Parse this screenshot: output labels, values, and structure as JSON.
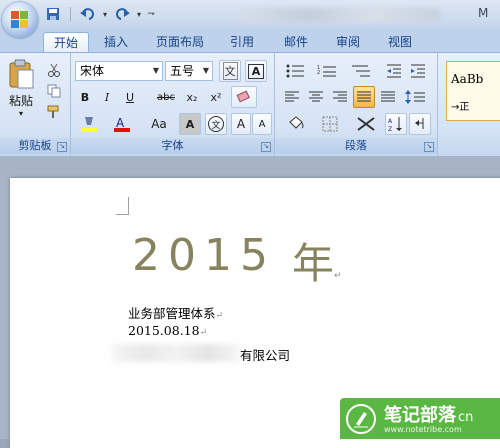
{
  "title_bar": {
    "title_suffix": "M"
  },
  "tabs": [
    "开始",
    "插入",
    "页面布局",
    "引用",
    "邮件",
    "审阅",
    "视图"
  ],
  "clipboard": {
    "paste_label": "粘贴",
    "group_label": "剪贴板"
  },
  "font": {
    "font_name": "宋体",
    "font_size": "五号",
    "bold": "B",
    "italic": "I",
    "underline": "U",
    "strike": "abc",
    "subscript": "x₂",
    "superscript": "x²",
    "change_case": "Aa",
    "grow": "A",
    "shrink": "A",
    "char_border": "A",
    "phonetic": "文",
    "group_label": "字体"
  },
  "paragraph": {
    "group_label": "段落"
  },
  "styles": {
    "preview": "AaBb",
    "name": "→正"
  },
  "document": {
    "year_digits": "2015",
    "year_char": "年",
    "line1": "业务部管理体系",
    "line2": "2015.08.18",
    "line3_suffix": "有限公司",
    "para_mark": "↵"
  },
  "watermark": {
    "name": "笔记部落",
    "suffix": "cn",
    "url": "www.notetribe.com"
  },
  "colors": {
    "accent": "#15428b",
    "year_color": "#86835e",
    "watermark_green": "#5bb744"
  }
}
